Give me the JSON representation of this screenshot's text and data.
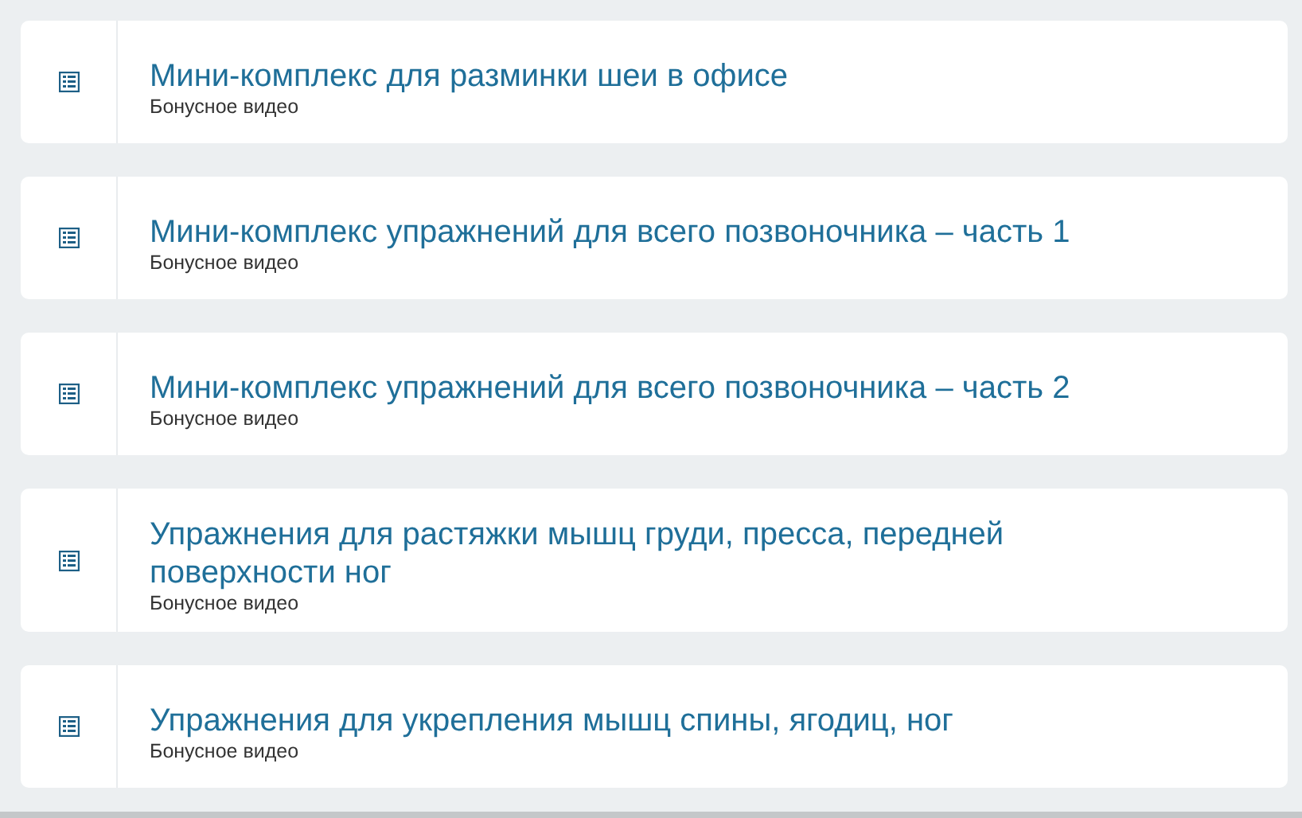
{
  "lessons": [
    {
      "title": "Мини-комплекс для разминки шеи в офисе",
      "subtitle": "Бонусное видео"
    },
    {
      "title": "Мини-комплекс упражнений для всего позвоночника – часть 1",
      "subtitle": "Бонусное видео"
    },
    {
      "title": "Мини-комплекс упражнений для всего позвоночника – часть 2",
      "subtitle": "Бонусное видео"
    },
    {
      "title": "Упражнения для растяжки мышц груди, пресса, передней поверхности ног",
      "subtitle": "Бонусное видео"
    },
    {
      "title": "Упражнения для укрепления мышц спины, ягодиц, ног",
      "subtitle": "Бонусное видео"
    }
  ]
}
